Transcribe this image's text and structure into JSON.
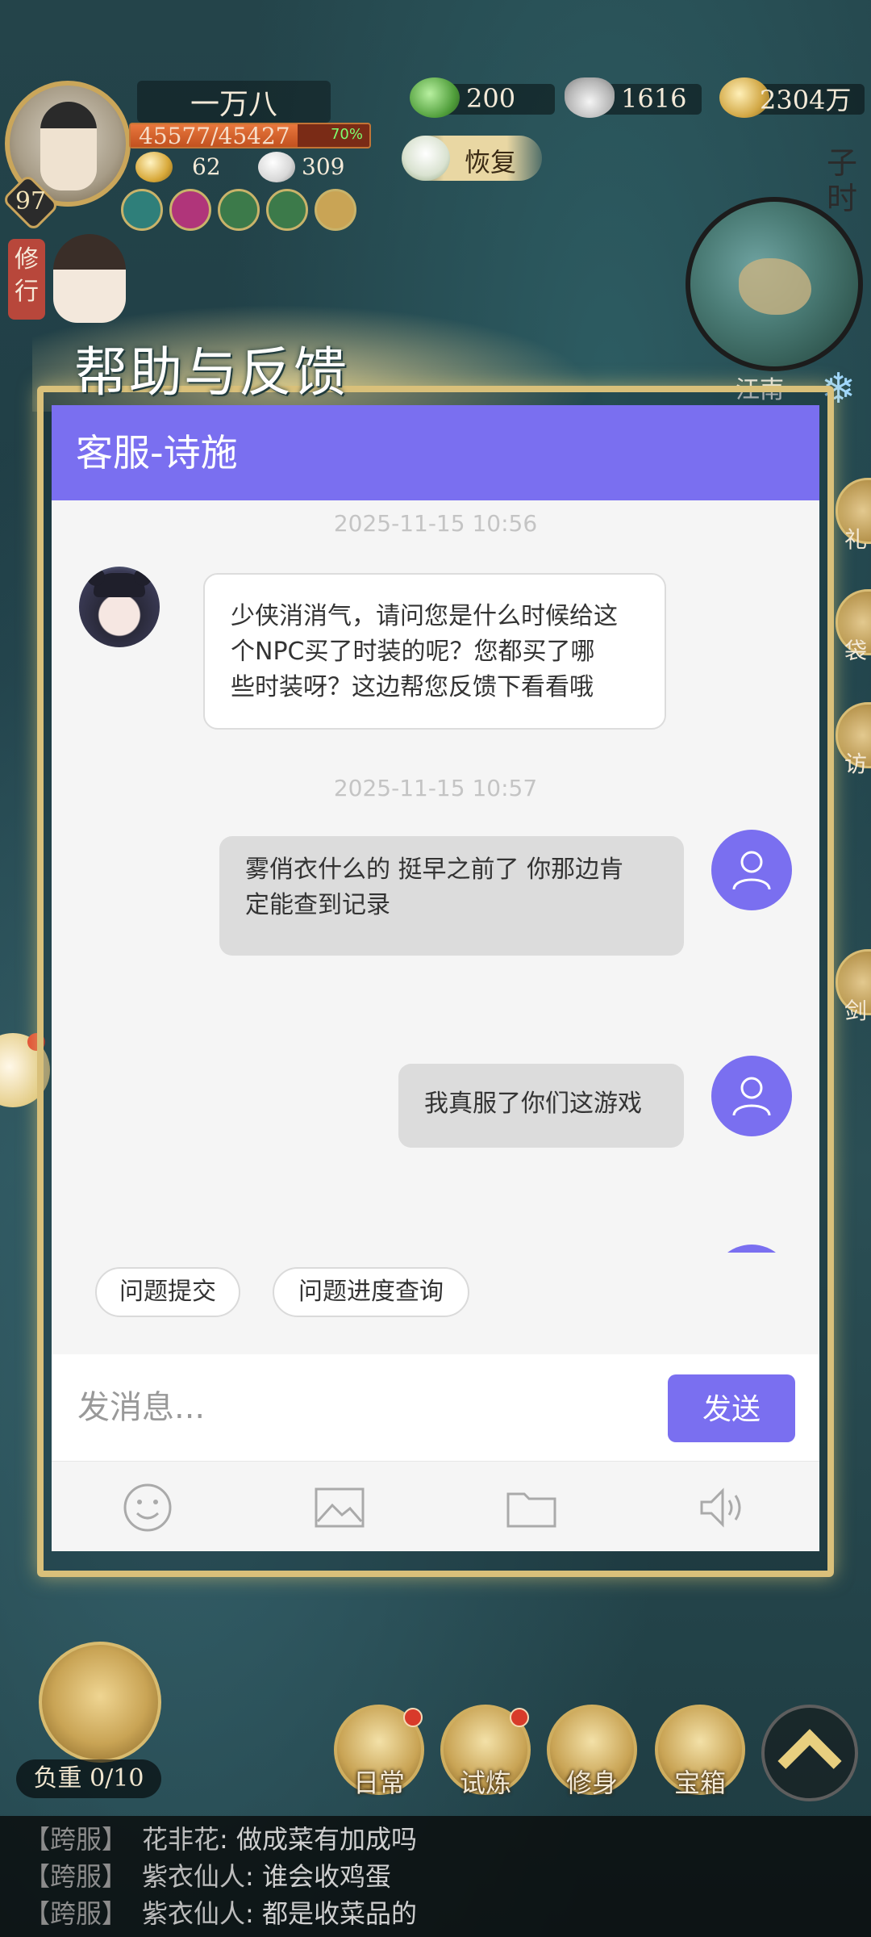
{
  "hud": {
    "player_name": "一万八",
    "hp_text": "45577/45427",
    "hp_percent": "70%",
    "hp_fill_fraction": 0.7,
    "level": "97",
    "stat_bowl": "62",
    "stat_bun": "309",
    "restore_label": "恢复",
    "xiuxing_label": "修行",
    "time_label": "子时",
    "map_area": "江南",
    "currencies": {
      "jade": "200",
      "silver": "1616",
      "gold": "2304万"
    },
    "side_tabs": [
      "礼",
      "袋",
      "访",
      "剑"
    ],
    "load_label": "负重 0/10",
    "bottom_buttons": [
      "日常",
      "试炼",
      "修身",
      "宝箱"
    ]
  },
  "dialog": {
    "heading": "帮助与反馈",
    "header_title": "客服-诗施",
    "messages": [
      {
        "from": "agent",
        "time": "2025-11-15 10:56",
        "lines": [
          "少侠消消气，请问您是什么时候给这",
          "个NPC买了时装的呢？您都买了哪",
          "些时装呀？这边帮您反馈下看看哦"
        ]
      },
      {
        "from": "user",
        "time": "2025-11-15 10:57",
        "lines": [
          "雾俏衣什么的 挺早之前了 你那边肯",
          "定能查到记录"
        ]
      },
      {
        "from": "user",
        "lines": [
          "我真服了你们这游戏"
        ]
      }
    ],
    "quick_actions": [
      "问题提交",
      "问题进度查询"
    ],
    "input_placeholder": "发消息...",
    "send_label": "发送",
    "toolbar": [
      "emoji-icon",
      "image-icon",
      "folder-icon",
      "voice-icon"
    ],
    "colors": {
      "accent": "#7a6ff0",
      "panel_bg": "#f5f5f5",
      "user_bubble": "#dcdcdc",
      "frame_gold": "#d9c07a"
    }
  },
  "chat_log": [
    {
      "channel": "【跨服】",
      "speaker": "花非花",
      "text": "做成菜有加成吗"
    },
    {
      "channel": "【跨服】",
      "speaker": "紫衣仙人",
      "text": "谁会收鸡蛋"
    },
    {
      "channel": "【跨服】",
      "speaker": "紫衣仙人",
      "text": "都是收菜品的"
    }
  ]
}
